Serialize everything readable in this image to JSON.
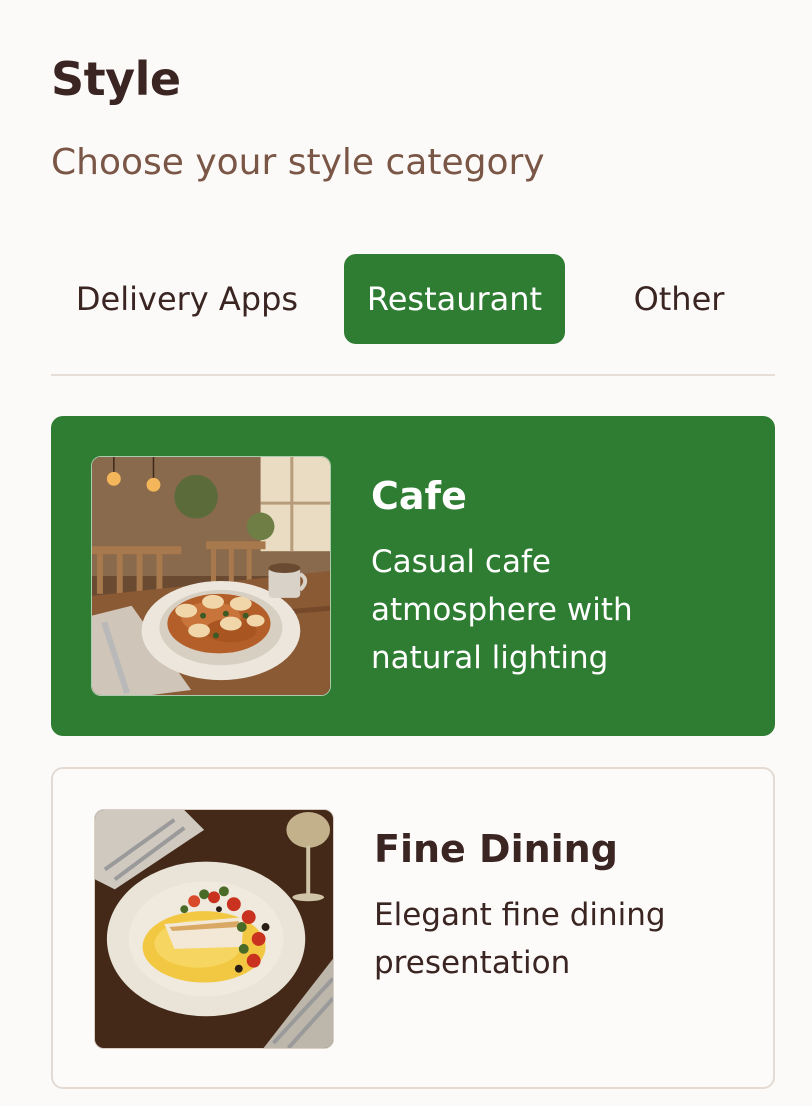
{
  "header": {
    "title": "Style",
    "subtitle": "Choose your style category"
  },
  "tabs": [
    {
      "label": "Delivery Apps",
      "selected": false
    },
    {
      "label": "Restaurant",
      "selected": true
    },
    {
      "label": "Other",
      "selected": false
    }
  ],
  "styles": [
    {
      "title": "Cafe",
      "description": "Casual cafe atmosphere with natural lighting",
      "selected": true,
      "image": "cafe-pasta-photo"
    },
    {
      "title": "Fine Dining",
      "description": "Elegant fine dining presentation",
      "selected": false,
      "image": "fine-dining-fish-photo"
    }
  ],
  "colors": {
    "accent": "#2e7d32",
    "text": "#3a2522",
    "subtitle": "#7a5646",
    "background": "#fcfaf8"
  }
}
